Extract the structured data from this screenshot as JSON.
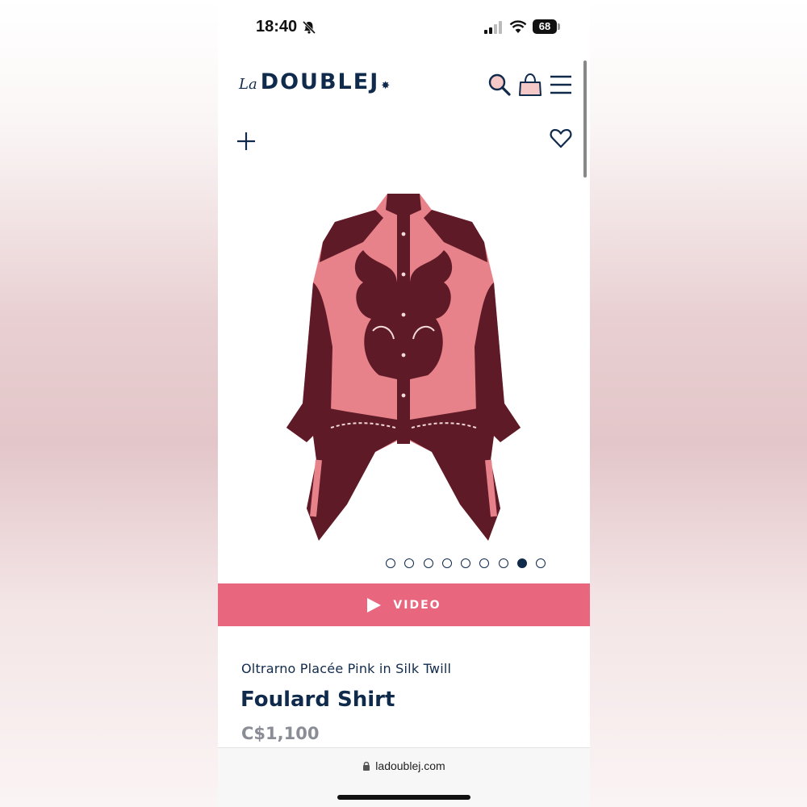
{
  "status_bar": {
    "time": "18:40",
    "battery": "68"
  },
  "header": {
    "logo_prefix": "La",
    "logo_main": "DOUBLEJ",
    "logo_star": "✸"
  },
  "carousel": {
    "total": 9,
    "active_index": 7
  },
  "video": {
    "label": "VIDEO"
  },
  "product": {
    "subtitle": "Oltrarno Placée Pink in Silk Twill",
    "title": "Foulard Shirt",
    "price": "C$1,100"
  },
  "browser": {
    "url": "ladoublej.com"
  },
  "colors": {
    "brand_navy": "#102a4c",
    "video_pink": "#e8677f",
    "shirt_pink": "#e8828a",
    "shirt_burgundy": "#5e1a26"
  }
}
